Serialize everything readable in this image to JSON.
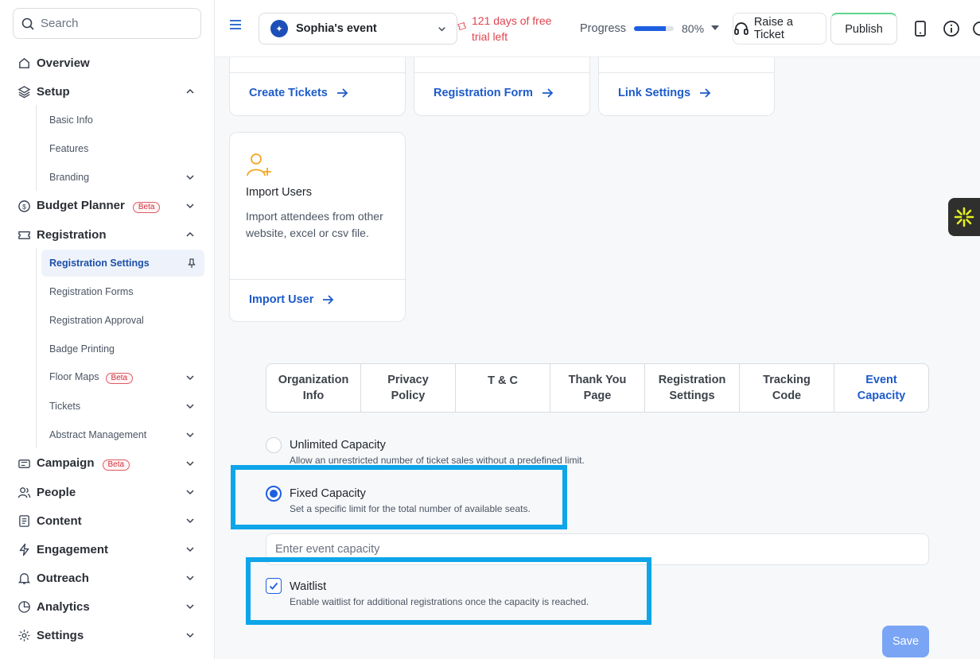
{
  "sidebar": {
    "search_placeholder": "Search",
    "items": {
      "overview": "Overview",
      "setup": "Setup",
      "basic_info": "Basic Info",
      "features": "Features",
      "branding": "Branding",
      "budget_planner": "Budget Planner",
      "registration": "Registration",
      "registration_settings": "Registration Settings",
      "registration_forms": "Registration Forms",
      "registration_approval": "Registration Approval",
      "badge_printing": "Badge Printing",
      "floor_maps": "Floor Maps",
      "tickets": "Tickets",
      "abstract_management": "Abstract Management",
      "campaign": "Campaign",
      "people": "People",
      "content": "Content",
      "engagement": "Engagement",
      "outreach": "Outreach",
      "analytics": "Analytics",
      "settings": "Settings"
    },
    "beta_label": "Beta"
  },
  "topbar": {
    "event_name": "Sophia's event",
    "trial_text": "121 days of free trial left",
    "progress_label": "Progress",
    "progress_value": 0.8,
    "progress_pct": "80%",
    "raise_ticket": "Raise a Ticket",
    "publish": "Publish"
  },
  "cards": {
    "create_tickets": "Create Tickets",
    "registration_form": "Registration Form",
    "link_settings": "Link Settings",
    "import_title": "Import Users",
    "import_desc": "Import attendees from other website, excel or csv file.",
    "import_link": "Import User"
  },
  "tabs": [
    {
      "label": "Organization\nInfo"
    },
    {
      "label": "Privacy\nPolicy"
    },
    {
      "label": "T & C"
    },
    {
      "label": "Thank You\nPage"
    },
    {
      "label": "Registration\nSettings"
    },
    {
      "label": "Tracking\nCode"
    },
    {
      "label": "Event\nCapacity"
    }
  ],
  "capacity": {
    "unlimited_title": "Unlimited Capacity",
    "unlimited_desc": "Allow an unrestricted number of ticket sales without a predefined limit.",
    "fixed_title": "Fixed Capacity",
    "fixed_desc": "Set a specific limit for the total number of available seats.",
    "input_placeholder": "Enter event capacity",
    "input_value": "",
    "waitlist_title": "Waitlist",
    "waitlist_desc": "Enable waitlist for additional registrations once the capacity is reached.",
    "save": "Save"
  },
  "colors": {
    "accent": "#1d5fe0",
    "link": "#1d5bc9",
    "highlight": "#0ea5e9",
    "trial_red": "#e0454f",
    "save_disabled": "#7aa5f5"
  }
}
